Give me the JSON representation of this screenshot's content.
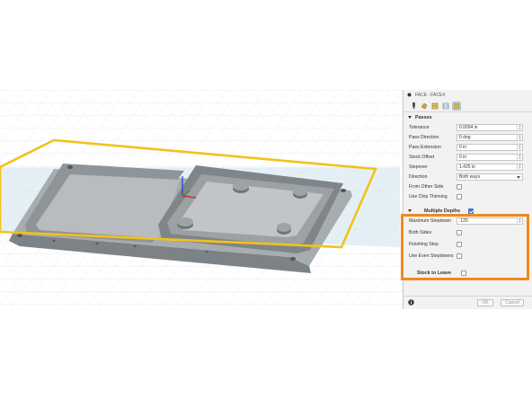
{
  "panel": {
    "title": "FACE : FACE4",
    "tabs": [
      "tool-tab",
      "geometry-tab",
      "heights-tab",
      "passes-tab",
      "linking-tab"
    ],
    "passes_section": {
      "title": "Passes",
      "rows": [
        {
          "label": "Tolerance",
          "value": "0.0004 in",
          "kind": "spin"
        },
        {
          "label": "Pass Direction",
          "value": "0 deg",
          "kind": "spin"
        },
        {
          "label": "Pass Extension",
          "value": "0 in",
          "kind": "spin"
        },
        {
          "label": "Stock Offset",
          "value": "0 in",
          "kind": "spin"
        },
        {
          "label": "Stepover",
          "value": "1.425 in",
          "kind": "spin"
        },
        {
          "label": "Direction",
          "value": "Both ways",
          "kind": "select"
        }
      ],
      "checks": [
        {
          "label": "From Other Side",
          "checked": false
        },
        {
          "label": "Use Chip Thinning",
          "checked": false
        }
      ]
    },
    "multiple_depths": {
      "title": "Multiple Depths",
      "checked": true,
      "max_stepdown_label": "Maximum Stepdown",
      "max_stepdown_value": ".125",
      "checks": [
        {
          "label": "Both Sides",
          "checked": false
        },
        {
          "label": "Finishing Step",
          "checked": false
        },
        {
          "label": "Use Even Stepdowns",
          "checked": false
        }
      ]
    },
    "stock_to_leave": {
      "title": "Stock to Leave",
      "checked": false
    },
    "ok_label": "OK",
    "cancel_label": "Cancel"
  },
  "colors": {
    "highlight": "#ef8a1e",
    "selection_line": "#f2c21a",
    "plane_fill": "#cfe3ee",
    "part": "#8e9497",
    "grid": "#d9dde2"
  }
}
